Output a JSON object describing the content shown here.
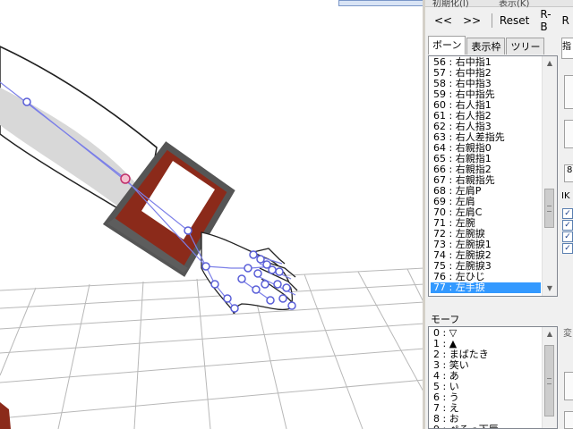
{
  "toolbar_partial": {
    "left_text": "初期化(I)",
    "right_text": "表示(K)"
  },
  "frame_nav": {
    "prev_label": "<<",
    "next_label": ">>",
    "reset_label": "Reset",
    "rb_label": "R-B",
    "partial_label": "R"
  },
  "bone_tabs": [
    {
      "label": "ボーン",
      "active": true
    },
    {
      "label": "表示枠",
      "active": false
    },
    {
      "label": "ツリー",
      "active": false
    }
  ],
  "bone_list": [
    "56 : 右中指1",
    "57 : 右中指2",
    "58 : 右中指3",
    "59 : 右中指先",
    "60 : 右人指1",
    "61 : 右人指2",
    "62 : 右人指3",
    "63 : 右人差指先",
    "64 : 右親指0",
    "65 : 右親指1",
    "66 : 右親指2",
    "67 : 右親指先",
    "68 : 左肩P",
    "69 : 左肩",
    "70 : 左肩C",
    "71 : 左腕",
    "72 : 左腕捩",
    "73 : 左腕捩1",
    "74 : 左腕捩2",
    "75 : 左腕捩3",
    "76 : 左ひじ",
    "77 : 左手捩"
  ],
  "bone_selected_index": 21,
  "morph_section_title": "モーフ",
  "morph_list": [
    "0 : ▽",
    "1 : ▲",
    "2 : まばたき",
    "3 : 笑い",
    "4 : あ",
    "5 : い",
    "6 : う",
    "7 : え",
    "8 : お",
    "9 : ぺろっ下唇"
  ],
  "side_partial": {
    "tab_label": "指",
    "button_label": "8",
    "ik_label": "IK",
    "checkbox_mark": "✓",
    "lower_label": "変"
  },
  "colors": {
    "accent_select": "#3399ff",
    "bone_line": "#7b7fe8",
    "cuff_red": "#8b2a1a",
    "grid": "#b0b0b0"
  }
}
